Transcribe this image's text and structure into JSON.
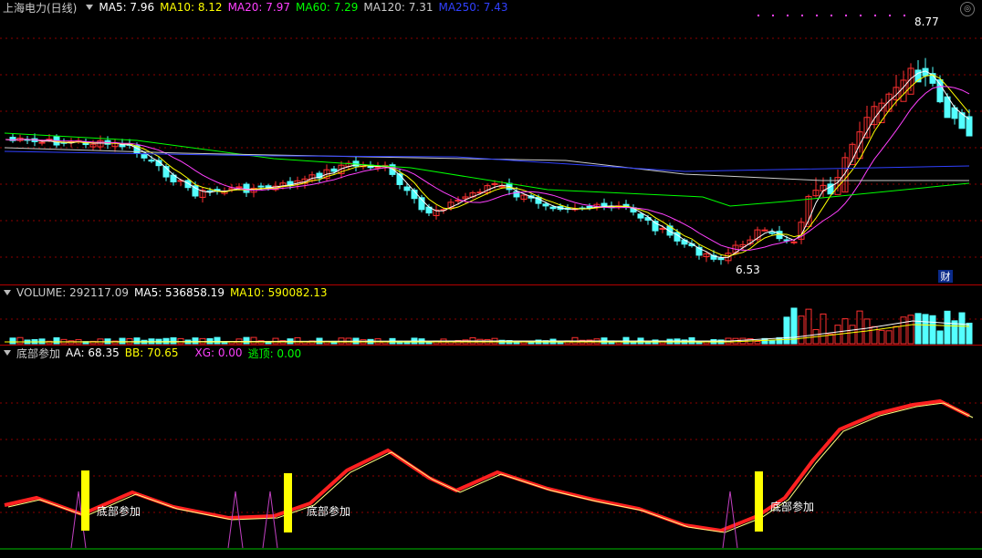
{
  "main": {
    "title": "上海电力(日线)",
    "ma": [
      {
        "label": "MA5: 7.96",
        "color": "#ffffff"
      },
      {
        "label": "MA10: 8.12",
        "color": "#ffff00"
      },
      {
        "label": "MA20: 7.97",
        "color": "#ff40ff"
      },
      {
        "label": "MA60: 7.29",
        "color": "#00ff00"
      },
      {
        "label": "MA120: 7.31",
        "color": "#cccccc"
      },
      {
        "label": "MA250: 7.43",
        "color": "#3040ff"
      }
    ],
    "high_label": "8.77",
    "low_label": "6.53",
    "cai_label": "财"
  },
  "volume": {
    "title": "VOLUME: 292117.09",
    "ma5": "MA5: 536858.19",
    "ma10": "MA10: 590082.13"
  },
  "indicator": {
    "title": "底部参加",
    "aa": "AA: 68.35",
    "bb": "BB: 70.65",
    "xg": "XG: 0.00",
    "taoding": "逃顶: 0.00",
    "signal_text": "底部参加"
  },
  "colors": {
    "up": "#ff3030",
    "down": "#54ffff",
    "grid": "#8b0000",
    "aa_line": "#ff2020",
    "bb_line": "#ffff80",
    "signal_bar": "#ffff00",
    "spike": "#c040c0"
  }
}
